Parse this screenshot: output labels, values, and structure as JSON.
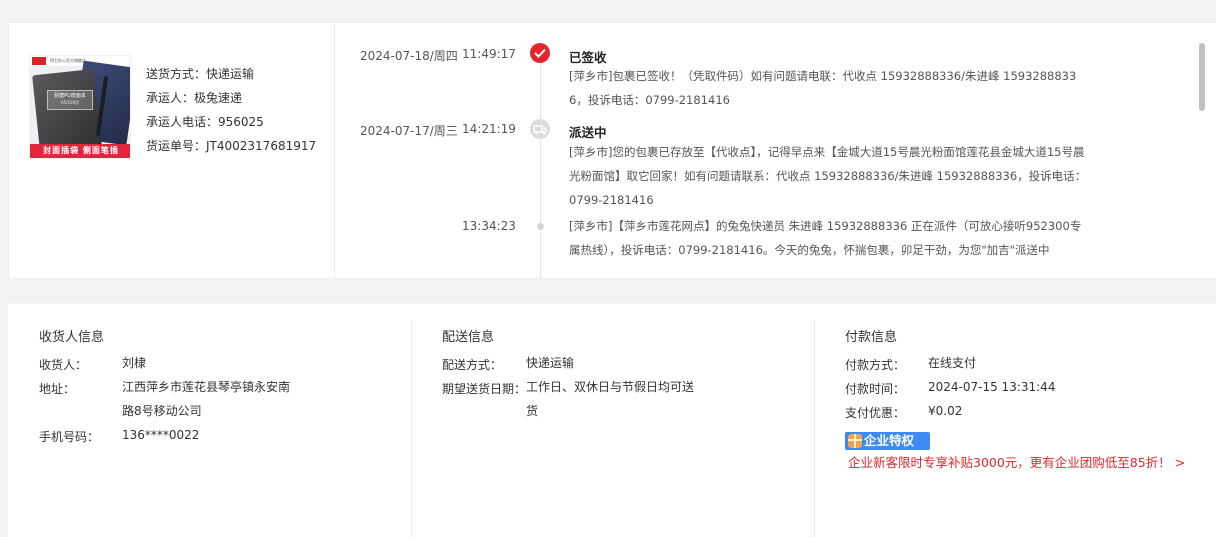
{
  "product": {
    "image_alt": "得力PU皮面本",
    "brand_text": "deli",
    "store_text": "得力办公官方旗舰店",
    "label_line1": "耐磨PU皮面本",
    "label_line2": "A5/100页",
    "banner_text": "封面插袋 侧面笔插"
  },
  "shipping": {
    "method": "送货方式：快递运输",
    "carrier": "承运人：极兔速递",
    "carrier_phone": "承运人电话：956025",
    "tracking_no": "货运单号：JT4002317681917"
  },
  "tracking": {
    "events": [
      {
        "date": "2024-07-18/周四",
        "time": "11:49:17",
        "status": "已签收",
        "desc": "[萍乡市]包裹已签收！（凭取件码）如有问题请电联：代收点 15932888336/朱进峰 15932888336，投诉电话：0799-2181416"
      },
      {
        "date": "2024-07-17/周三",
        "time": "14:21:19",
        "status": "派送中",
        "desc": "[萍乡市]您的包裹已存放至【代收点】，记得早点来【金城大道15号晨光粉面馆莲花县金城大道15号晨光粉面馆】取它回家！如有问题请联系：代收点 15932888336/朱进峰 15932888336，投诉电话：0799-2181416"
      },
      {
        "date": "",
        "time": "13:34:23",
        "status": "",
        "desc": "[萍乡市]【萍乡市莲花网点】的兔兔快递员 朱进峰 15932888336 正在派件（可放心接听952300专属热线），投诉电话：0799-2181416。今天的兔兔，怀揣包裹，卯足干劲，为您\"加吉\"派送中"
      }
    ]
  },
  "receiver": {
    "title": "收货人信息",
    "name_label": "收货人：",
    "name": "刘棣",
    "address_label": "地址：",
    "address": "江西萍乡市莲花县琴亭镇永安南路8号移动公司",
    "phone_label": "手机号码：",
    "phone": "136****0022"
  },
  "delivery": {
    "title": "配送信息",
    "method_label": "配送方式：",
    "method": "快递运输",
    "date_label": "期望送货日期：",
    "date": "工作日、双休日与节假日均可送货"
  },
  "payment": {
    "title": "付款信息",
    "method_label": "付款方式：",
    "method": "在线支付",
    "time_label": "付款时间：",
    "time": "2024-07-15 13:31:44",
    "discount_label": "支付优惠：",
    "discount": "¥0.02",
    "enterprise_badge": "企业特权",
    "promo_text": "企业新客限时专享补贴3000元，更有企业团购低至85折！ >"
  },
  "colors": {
    "accent_red": "#e3262d",
    "badge_blue": "#3d8af5"
  }
}
